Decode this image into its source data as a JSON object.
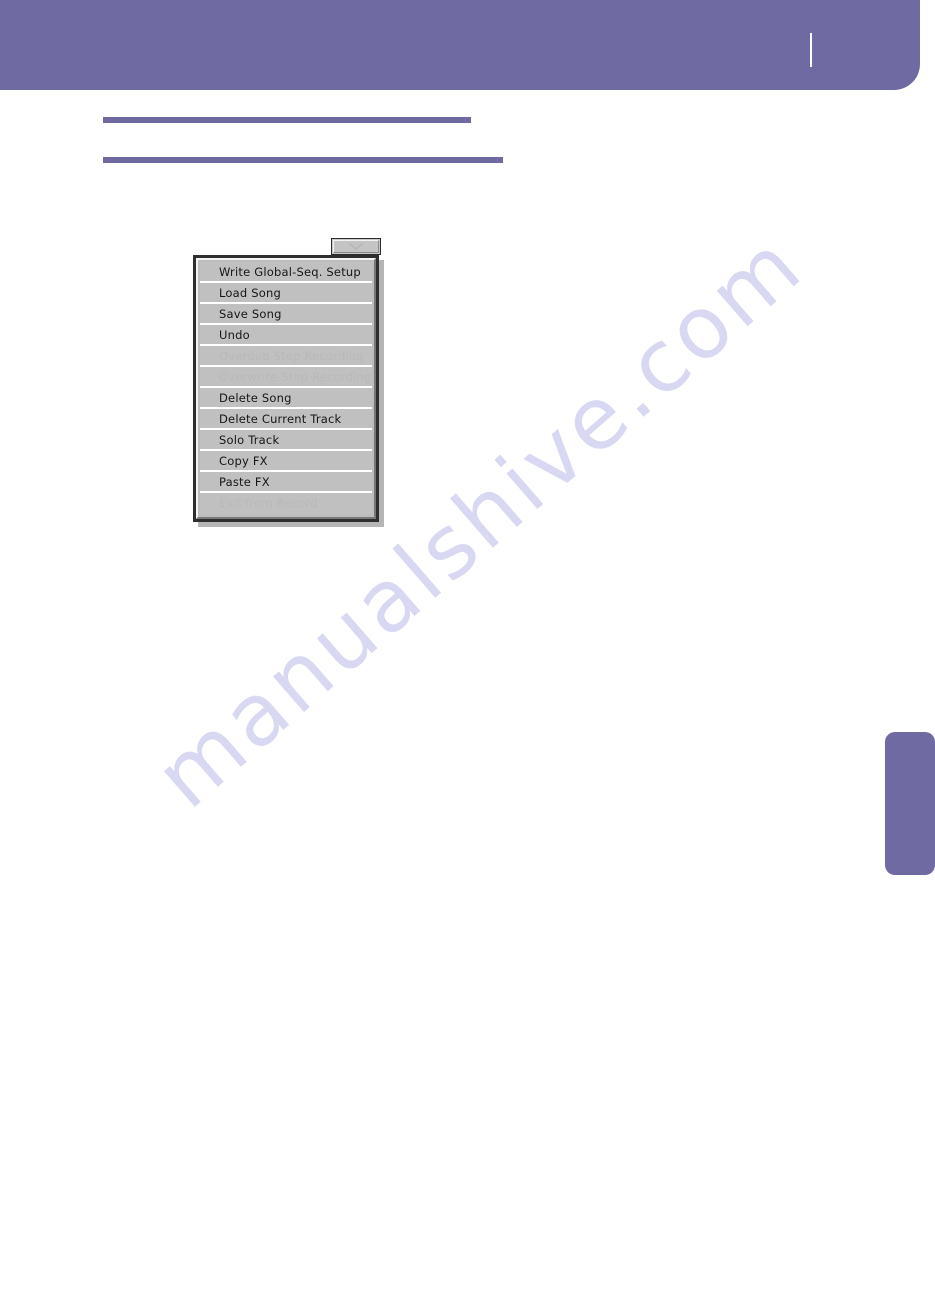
{
  "page": {
    "background_color": "#ffffff",
    "accent_color": "#6f6ba2",
    "watermark_text": "manualshive.com"
  },
  "header": {
    "band_color": "#6f6ba2"
  },
  "rules": {
    "top_color": "#6f6ba2",
    "second_color": "#6f6ba2"
  },
  "side_tab": {
    "color": "#6f6ba2"
  },
  "page_menu_button": {
    "icon": "triangle-down-icon"
  },
  "menu": {
    "items": [
      {
        "label": "Write Global-Seq. Setup",
        "enabled": true
      },
      {
        "label": "Load Song",
        "enabled": true
      },
      {
        "label": "Save Song",
        "enabled": true
      },
      {
        "label": "Undo",
        "enabled": true
      },
      {
        "label": "Overdub Step Recording",
        "enabled": false
      },
      {
        "label": "Overwrite Step Recording",
        "enabled": false
      },
      {
        "label": "Delete Song",
        "enabled": true
      },
      {
        "label": "Delete Current Track",
        "enabled": true
      },
      {
        "label": "Solo Track",
        "enabled": true
      },
      {
        "label": "Copy FX",
        "enabled": true
      },
      {
        "label": "Paste FX",
        "enabled": true
      },
      {
        "label": "Exit from Record",
        "enabled": false
      }
    ]
  }
}
